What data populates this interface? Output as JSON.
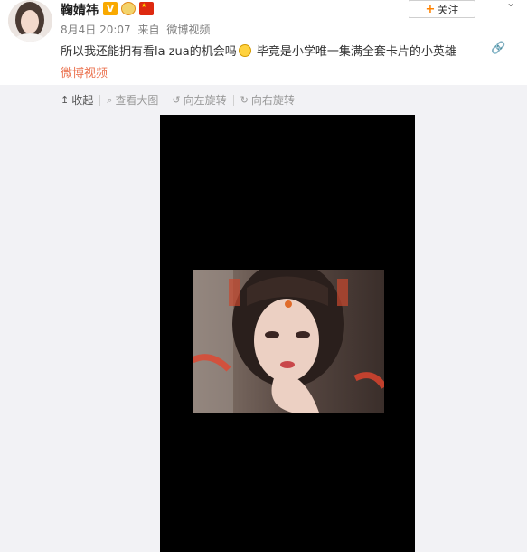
{
  "user": {
    "name": "鞠婧祎"
  },
  "badges": [
    "verified-v-badge",
    "medal-badge",
    "china-flag-badge"
  ],
  "follow_button": {
    "plus": "+",
    "label": "关注"
  },
  "meta": {
    "date": "8月4日 20:07",
    "source_prefix": "来自",
    "source": "微博视频"
  },
  "post": {
    "text_before": "所以我还能拥有看la zua的机会吗",
    "text_after": " 毕竟是小学唯一集满全套卡片的小英雄",
    "video_link": "微博视频"
  },
  "toolbar": {
    "collapse": "收起",
    "view_large": "查看大图",
    "rotate_left": "向左旋转",
    "rotate_right": "向右旋转"
  },
  "colors": {
    "accent": "#eb7350",
    "follow_plus": "#ff8200",
    "media_bg": "#000000"
  }
}
